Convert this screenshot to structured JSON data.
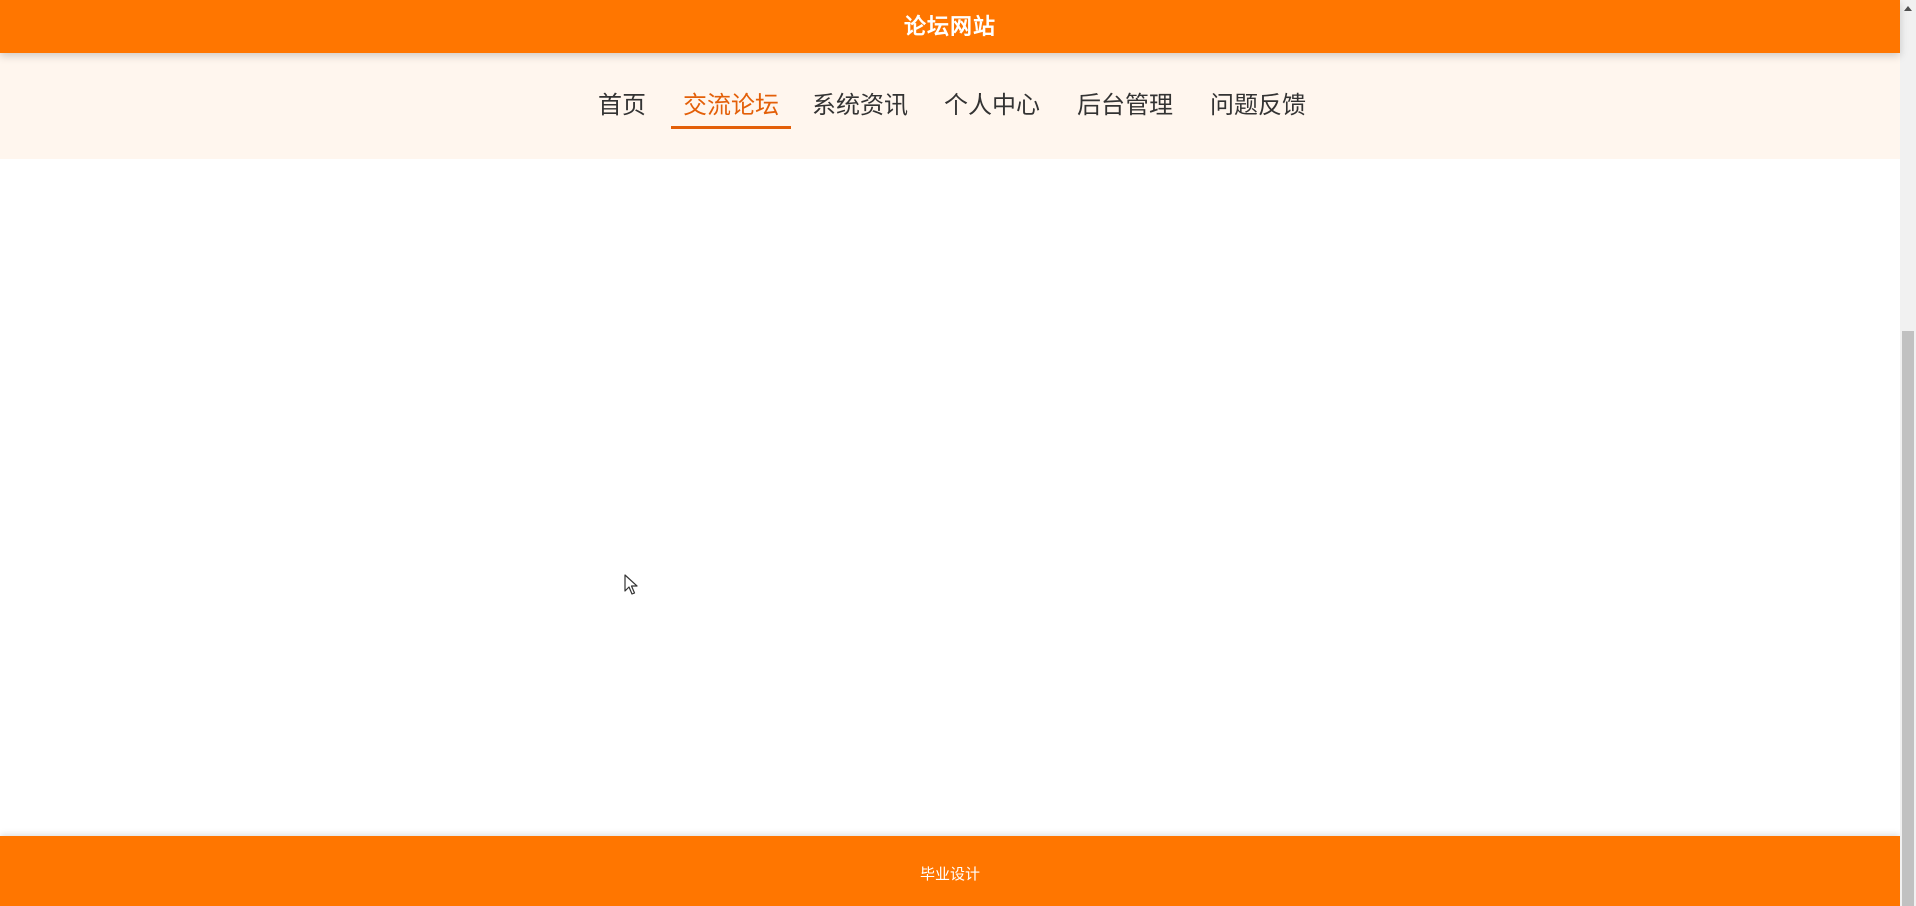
{
  "site": {
    "title": "论坛网站"
  },
  "nav": {
    "items": [
      {
        "label": "首页"
      },
      {
        "label": "交流论坛"
      },
      {
        "label": "系统资讯"
      },
      {
        "label": "个人中心"
      },
      {
        "label": "后台管理"
      },
      {
        "label": "问题反馈"
      }
    ],
    "active_label": "交流论坛"
  },
  "footer": {
    "text": "毕业设计"
  },
  "colors": {
    "brand_orange": "#ff7600",
    "nav_background": "#fff6ee",
    "active_nav": "#e35f08",
    "nav_text": "#333333"
  },
  "icons": {
    "cursor": "mouse-pointer-icon",
    "scroll_up": "scroll-up-arrow-icon"
  }
}
